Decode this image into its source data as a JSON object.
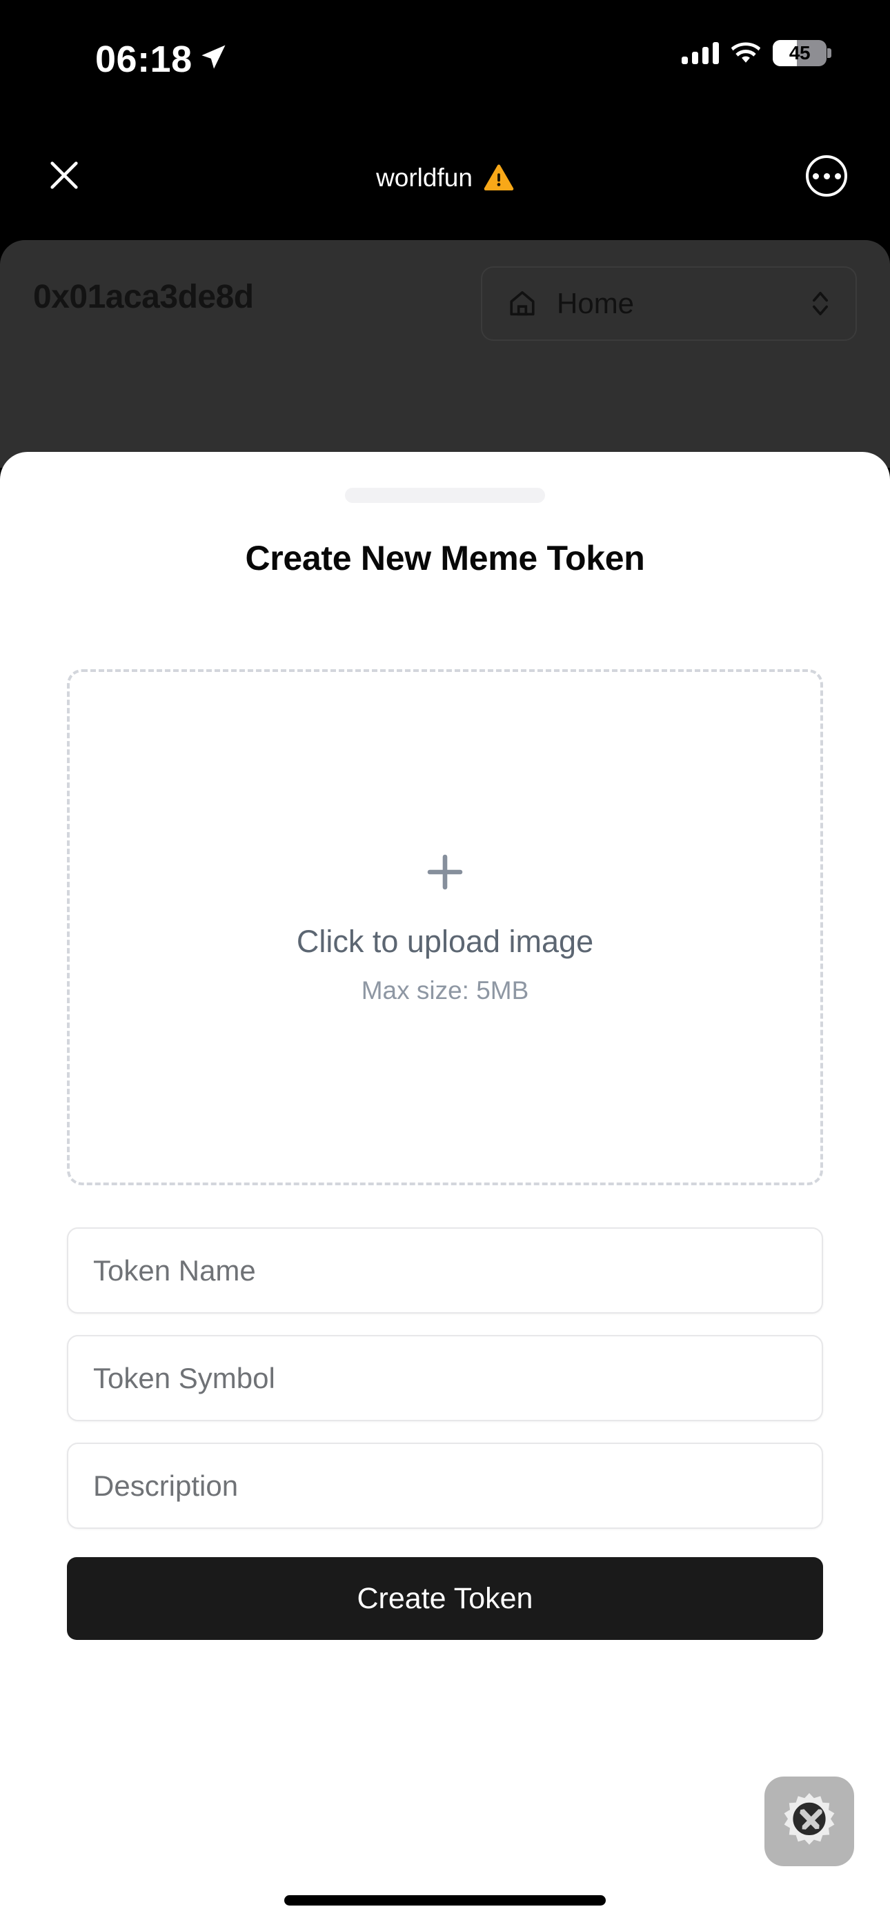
{
  "status_bar": {
    "time": "06:18",
    "location_icon": "location-arrow-icon",
    "cellular_icon": "cellular-bars-icon",
    "wifi_icon": "wifi-icon",
    "battery_percent": "45",
    "battery_level": 45
  },
  "browser_nav": {
    "close_icon": "close-x-icon",
    "title": "worldfun",
    "warning_icon": "warning-triangle-icon",
    "warning_color": "#f8a818",
    "more_icon": "more-ellipsis-circle-icon"
  },
  "webpage": {
    "wallet_address": "0x01aca3de8d",
    "page_select": {
      "icon": "home-house-icon",
      "label": "Home",
      "chevron_icon": "chevron-up-down-icon"
    },
    "background_color": "#303030"
  },
  "sheet": {
    "handle": "drag-handle",
    "title": "Create New Meme Token",
    "upload": {
      "icon": "plus-icon",
      "primary_text": "Click to upload image",
      "secondary_text": "Max size: 5MB"
    },
    "fields": [
      {
        "name": "token-name",
        "placeholder": "Token Name",
        "value": ""
      },
      {
        "name": "token-symbol",
        "placeholder": "Token Symbol",
        "value": ""
      },
      {
        "name": "description",
        "placeholder": "Description",
        "value": ""
      }
    ],
    "submit_label": "Create Token",
    "submit_color": "#1a1a1a"
  },
  "overlay": {
    "devtools_icon": "gear-tools-icon"
  },
  "system": {
    "home_indicator": "home-indicator"
  }
}
